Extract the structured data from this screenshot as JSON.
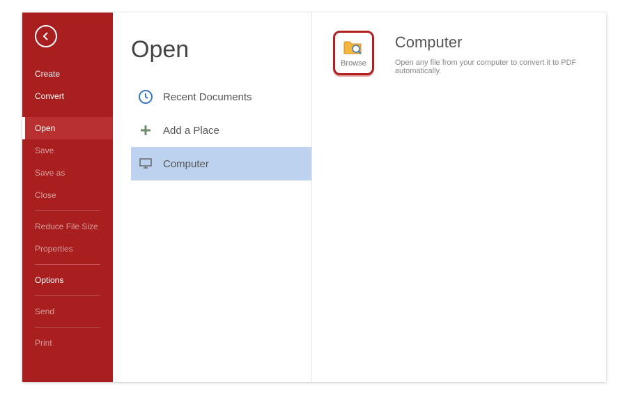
{
  "sidebar": {
    "items": [
      {
        "label": "Create",
        "dim": false
      },
      {
        "label": "Convert",
        "dim": false
      },
      {
        "label": "Open",
        "selected": true
      },
      {
        "label": "Save",
        "dim": true
      },
      {
        "label": "Save as",
        "dim": true
      },
      {
        "label": "Close",
        "dim": true
      },
      {
        "label": "Reduce File Size",
        "dim": true
      },
      {
        "label": "Properties",
        "dim": true
      },
      {
        "label": "Options",
        "dim": false
      },
      {
        "label": "Send",
        "dim": true
      },
      {
        "label": "Print",
        "dim": true
      }
    ]
  },
  "page": {
    "title": "Open"
  },
  "sources": [
    {
      "key": "recent",
      "label": "Recent Documents"
    },
    {
      "key": "addplace",
      "label": "Add a Place"
    },
    {
      "key": "computer",
      "label": "Computer",
      "selected": true
    }
  ],
  "browse": {
    "label": "Browse"
  },
  "detail": {
    "title": "Computer",
    "description": "Open any file from your computer to convert it to PDF automatically."
  }
}
